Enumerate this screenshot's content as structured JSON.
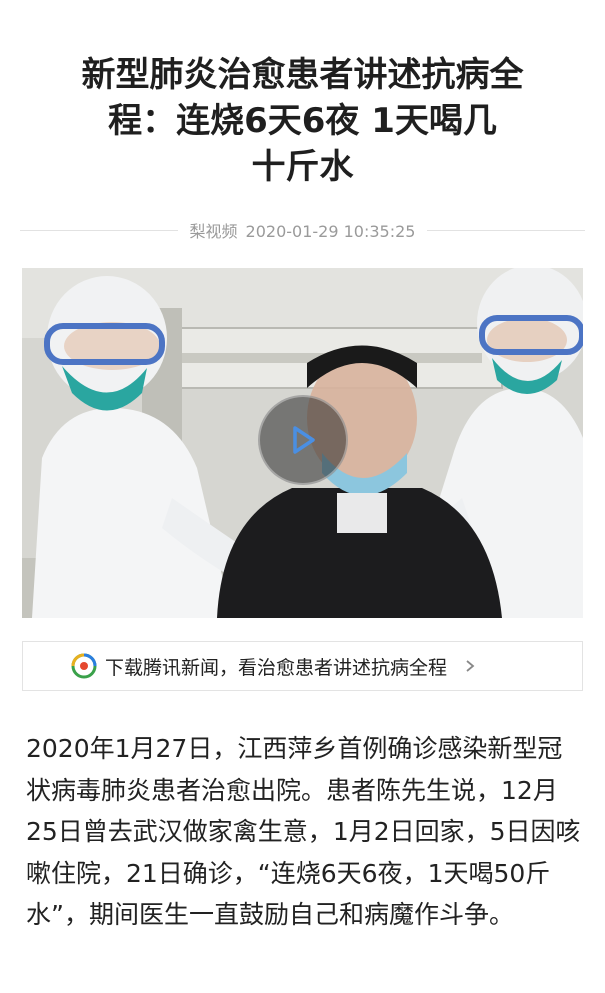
{
  "article": {
    "title_line1": "新型肺炎治愈患者讲述抗病全",
    "title_line2": "程：连烧6天6夜 1天喝几",
    "title_line3": "十斤水",
    "source": "梨视频",
    "datetime": "2020-01-29 10:35:25"
  },
  "banner": {
    "label": "下载腾讯新闻，看治愈患者讲述抗病全程",
    "logo_icon": "tencent-news-logo-icon",
    "chevron_icon": "chevron-right-icon"
  },
  "body": {
    "paragraph": "2020年1月27日，江西萍乡首例确诊感染新型冠状病毒肺炎患者治愈出院。患者陈先生说，12月25日曾去武汉做家禽生意，1月2日回家，5日因咳嗽住院，21日确诊，“连烧6天6夜，1天喝50斤水”，期间医生一直鼓励自己和病魔作斗争。"
  },
  "video": {
    "play_icon": "play-icon"
  },
  "colors": {
    "accent_blue": "#4a8fe3",
    "text": "#222222",
    "meta": "#9a9a9a"
  }
}
